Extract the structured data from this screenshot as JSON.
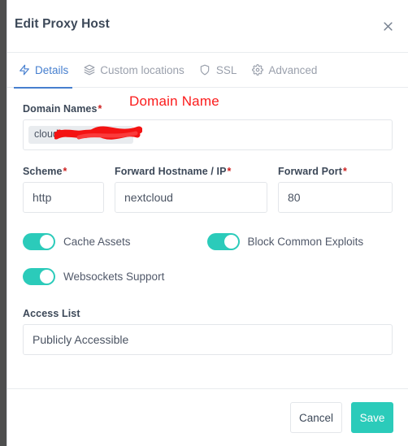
{
  "window": {
    "title": "Edit Proxy Host",
    "close_icon": "close-icon"
  },
  "tabs": [
    {
      "label": "Details",
      "icon": "zap-icon",
      "active": true
    },
    {
      "label": "Custom locations",
      "icon": "layers-icon",
      "active": false
    },
    {
      "label": "SSL",
      "icon": "shield-icon",
      "active": false
    },
    {
      "label": "Advanced",
      "icon": "gear-icon",
      "active": false
    }
  ],
  "form": {
    "domain_names": {
      "label": "Domain Names",
      "required_marker": "*",
      "tag_value": "cloud.",
      "tag_redacted_suffix": "redacted"
    },
    "scheme": {
      "label": "Scheme",
      "required_marker": "*",
      "value": "http"
    },
    "forward_hostname": {
      "label": "Forward Hostname / IP",
      "required_marker": "*",
      "value": "nextcloud"
    },
    "forward_port": {
      "label": "Forward Port",
      "required_marker": "*",
      "value": "80"
    },
    "toggles": [
      {
        "label": "Cache Assets",
        "on": true
      },
      {
        "label": "Block Common Exploits",
        "on": true
      },
      {
        "label": "Websockets Support",
        "on": true
      }
    ],
    "access_list": {
      "label": "Access List",
      "value": "Publicly Accessible"
    }
  },
  "annotations": [
    {
      "text": "Domain Name",
      "color": "#fb1b1b"
    }
  ],
  "footer": {
    "cancel_label": "Cancel",
    "save_label": "Save"
  },
  "colors": {
    "accent_teal": "#2bcbba",
    "accent_blue": "#467fcf",
    "required_red": "#cd201f",
    "annotation_red": "#fb1b1b",
    "text_dark": "#3c4858",
    "text_muted": "#9aa0ac",
    "border": "#e9ecef"
  }
}
